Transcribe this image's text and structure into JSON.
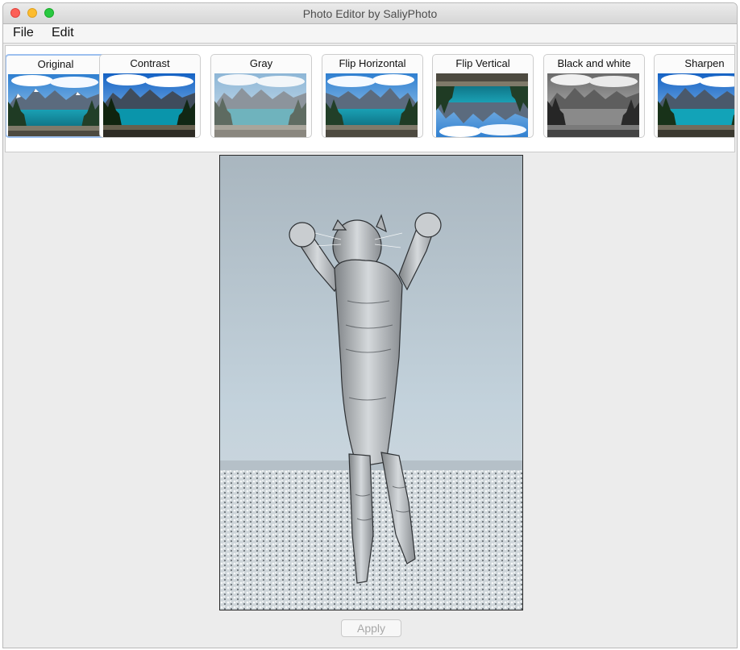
{
  "window": {
    "title": "Photo Editor by SaliyPhoto"
  },
  "menu": {
    "file": "File",
    "edit": "Edit"
  },
  "filters": [
    {
      "label": "Original",
      "selected": true
    },
    {
      "label": "Contrast",
      "selected": false
    },
    {
      "label": "Gray",
      "selected": false
    },
    {
      "label": "Flip Horizontal",
      "selected": false
    },
    {
      "label": "Flip Vertical",
      "selected": false
    },
    {
      "label": "Black and white",
      "selected": false
    },
    {
      "label": "Sharpen",
      "selected": false
    }
  ],
  "actions": {
    "apply": "Apply",
    "apply_enabled": false
  },
  "colors": {
    "selected_border": "#9dc0ef",
    "close": "#fc5f57",
    "minimize": "#fdbc2e",
    "zoom": "#28c840"
  }
}
